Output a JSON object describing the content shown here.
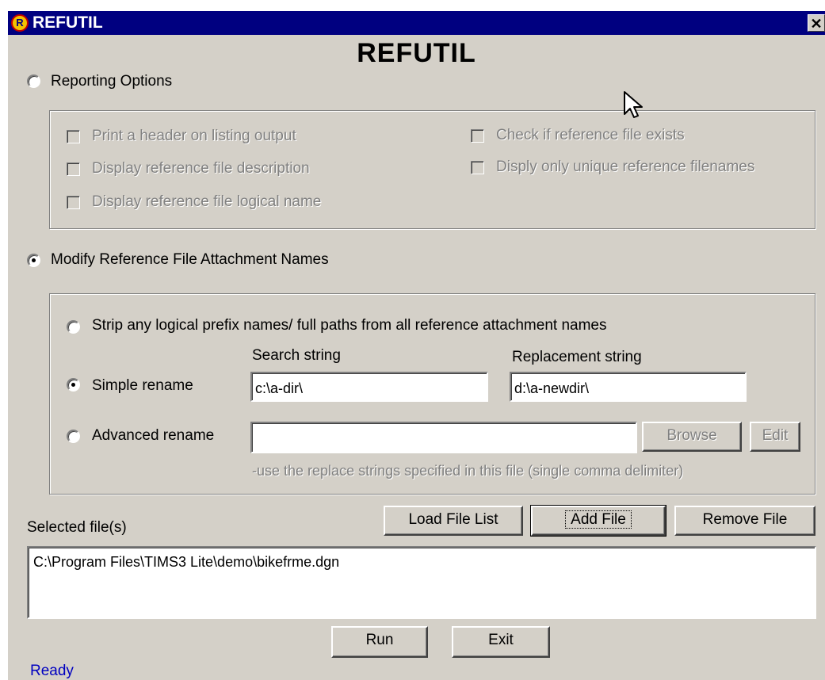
{
  "window": {
    "title": "REFUTIL",
    "app_icon_glyph": "R"
  },
  "heading": "REFUTIL",
  "reporting": {
    "label": "Reporting Options",
    "selected": false,
    "options_left": [
      "Print a header on listing output",
      "Display reference file description",
      "Display reference file logical name"
    ],
    "options_right": [
      "Check if reference file exists",
      "Disply only unique reference filenames"
    ]
  },
  "modify": {
    "label": "Modify Reference File Attachment Names",
    "selected": true,
    "strip_label": "Strip any logical prefix names/ full paths from all reference attachment names",
    "search_label": "Search string",
    "replacement_label": "Replacement string",
    "simple_label": "Simple rename",
    "search_value": "c:\\a-dir\\",
    "replacement_value": "d:\\a-newdir\\",
    "advanced_label": "Advanced rename",
    "advanced_value": "",
    "browse_label": "Browse",
    "edit_label": "Edit",
    "hint": "-use the replace strings specified in this file (single comma delimiter)"
  },
  "files": {
    "label": "Selected file(s)",
    "load_label": "Load File List",
    "add_label": "Add File",
    "remove_label": "Remove File",
    "items": [
      "C:\\Program Files\\TIMS3 Lite\\demo\\bikefrme.dgn"
    ]
  },
  "actions": {
    "run_label": "Run",
    "exit_label": "Exit"
  },
  "status": "Ready"
}
